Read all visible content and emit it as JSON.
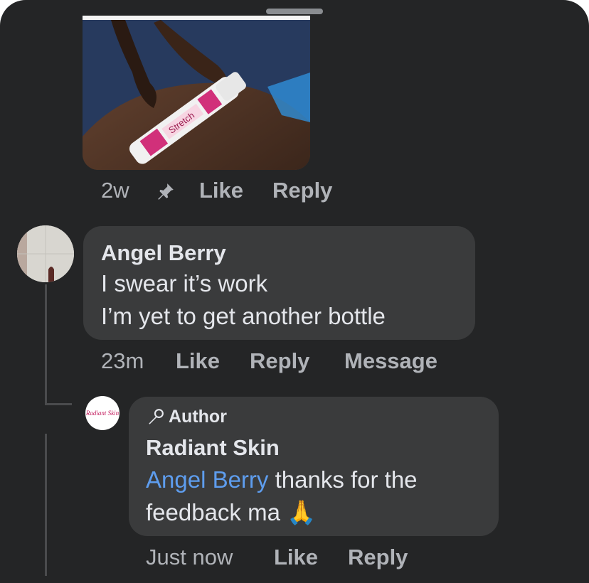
{
  "top_comment": {
    "time": "2w",
    "icon": "pin-icon",
    "like_label": "Like",
    "reply_label": "Reply"
  },
  "comment_1": {
    "author": "Angel Berry",
    "lines": [
      "I swear it’s work",
      "I’m yet to get another bottle"
    ],
    "time": "23m",
    "like_label": "Like",
    "reply_label": "Reply",
    "message_label": "Message"
  },
  "reply_1": {
    "avatar_text": "Radiant Skin",
    "badge_icon": "microphone-icon",
    "badge_label": "Author",
    "author": "Radiant Skin",
    "mention": "Angel Berry",
    "text_after_mention": " thanks for the",
    "text_line2": "feedback ma ",
    "emoji": "🙏",
    "time": "Just now",
    "like_label": "Like",
    "reply_label": "Reply"
  },
  "photo_label": "Stretch"
}
